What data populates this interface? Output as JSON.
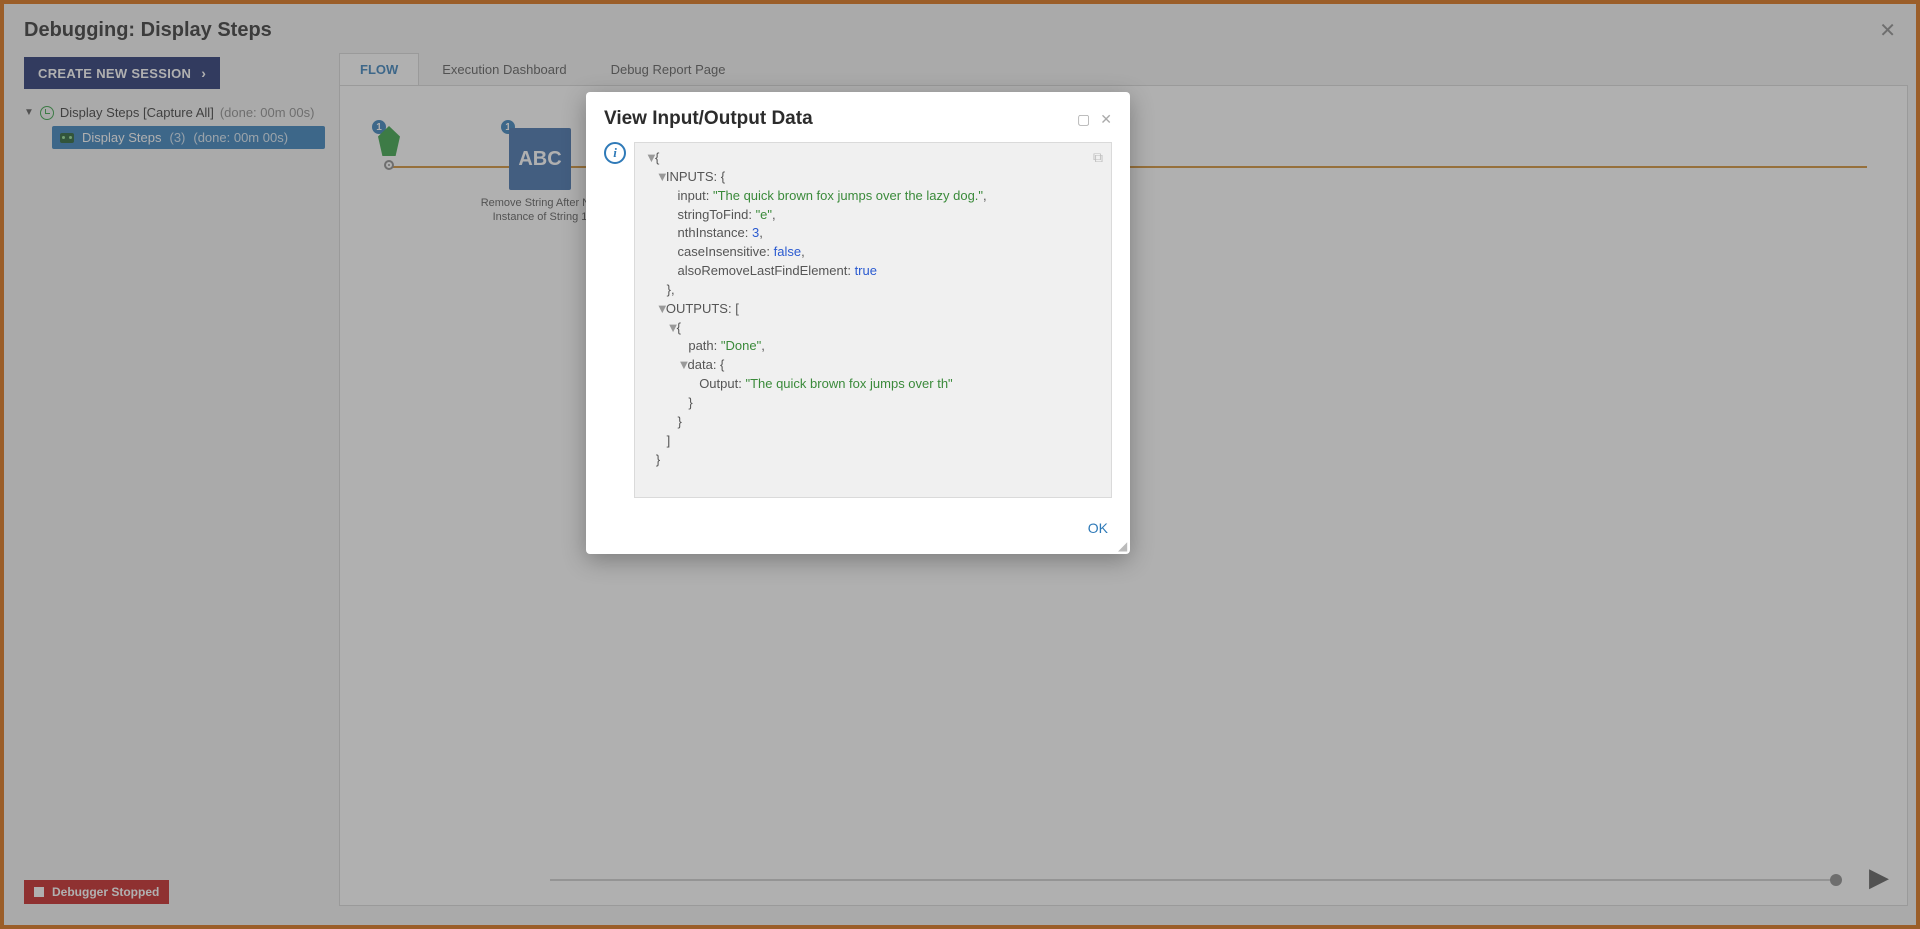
{
  "header": {
    "title": "Debugging: Display Steps"
  },
  "sidebar": {
    "createButton": "CREATE NEW SESSION",
    "root": {
      "label": "Display Steps [Capture All]",
      "done": "(done: 00m 00s)"
    },
    "child": {
      "label": "Display Steps",
      "count": "(3)",
      "done": "(done: 00m 00s)"
    },
    "status": "Debugger Stopped"
  },
  "tabs": [
    "FLOW",
    "Execution Dashboard",
    "Debug Report Page"
  ],
  "flow": {
    "startBadge": "1",
    "abc": {
      "badge": "1",
      "text": "ABC",
      "label1": "Remove String After Nth",
      "label2": "Instance of String 1"
    }
  },
  "modal": {
    "title": "View Input/Output Data",
    "ok": "OK",
    "data": {
      "inputs": {
        "input": "\"The quick brown fox jumps over the lazy dog.\"",
        "stringToFind": "\"e\"",
        "nthInstance": "3",
        "caseInsensitive": "false",
        "alsoRemoveLastFindElement": "true"
      },
      "outputs": {
        "path": "\"Done\"",
        "output": "\"The quick brown fox jumps over th\""
      }
    }
  }
}
